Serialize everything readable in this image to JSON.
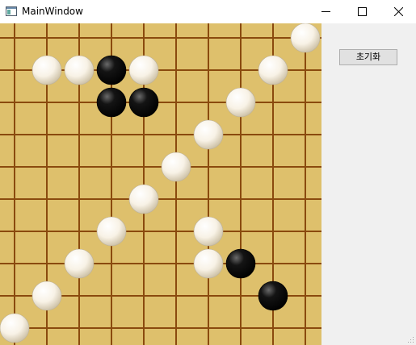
{
  "window": {
    "title": "MainWindow",
    "icon": "app-window-icon",
    "controls": [
      "minimize-icon",
      "maximize-icon",
      "close-icon"
    ]
  },
  "board": {
    "line_color": "#8a4a0e",
    "background": "#dec06c",
    "stones": [
      {
        "col": 9,
        "row": 0,
        "color": "white"
      },
      {
        "col": 1,
        "row": 1,
        "color": "white"
      },
      {
        "col": 2,
        "row": 1,
        "color": "white"
      },
      {
        "col": 3,
        "row": 1,
        "color": "black"
      },
      {
        "col": 4,
        "row": 1,
        "color": "white"
      },
      {
        "col": 8,
        "row": 1,
        "color": "white"
      },
      {
        "col": 3,
        "row": 2,
        "color": "black"
      },
      {
        "col": 4,
        "row": 2,
        "color": "black"
      },
      {
        "col": 7,
        "row": 2,
        "color": "white"
      },
      {
        "col": 6,
        "row": 3,
        "color": "white"
      },
      {
        "col": 5,
        "row": 4,
        "color": "white"
      },
      {
        "col": 4,
        "row": 5,
        "color": "white"
      },
      {
        "col": 3,
        "row": 6,
        "color": "white"
      },
      {
        "col": 6,
        "row": 6,
        "color": "white"
      },
      {
        "col": 2,
        "row": 7,
        "color": "white"
      },
      {
        "col": 6,
        "row": 7,
        "color": "white"
      },
      {
        "col": 7,
        "row": 7,
        "color": "black"
      },
      {
        "col": 1,
        "row": 8,
        "color": "white"
      },
      {
        "col": 8,
        "row": 8,
        "color": "black"
      },
      {
        "col": 0,
        "row": 9,
        "color": "white"
      }
    ]
  },
  "side_panel": {
    "reset_label": "초기화"
  }
}
